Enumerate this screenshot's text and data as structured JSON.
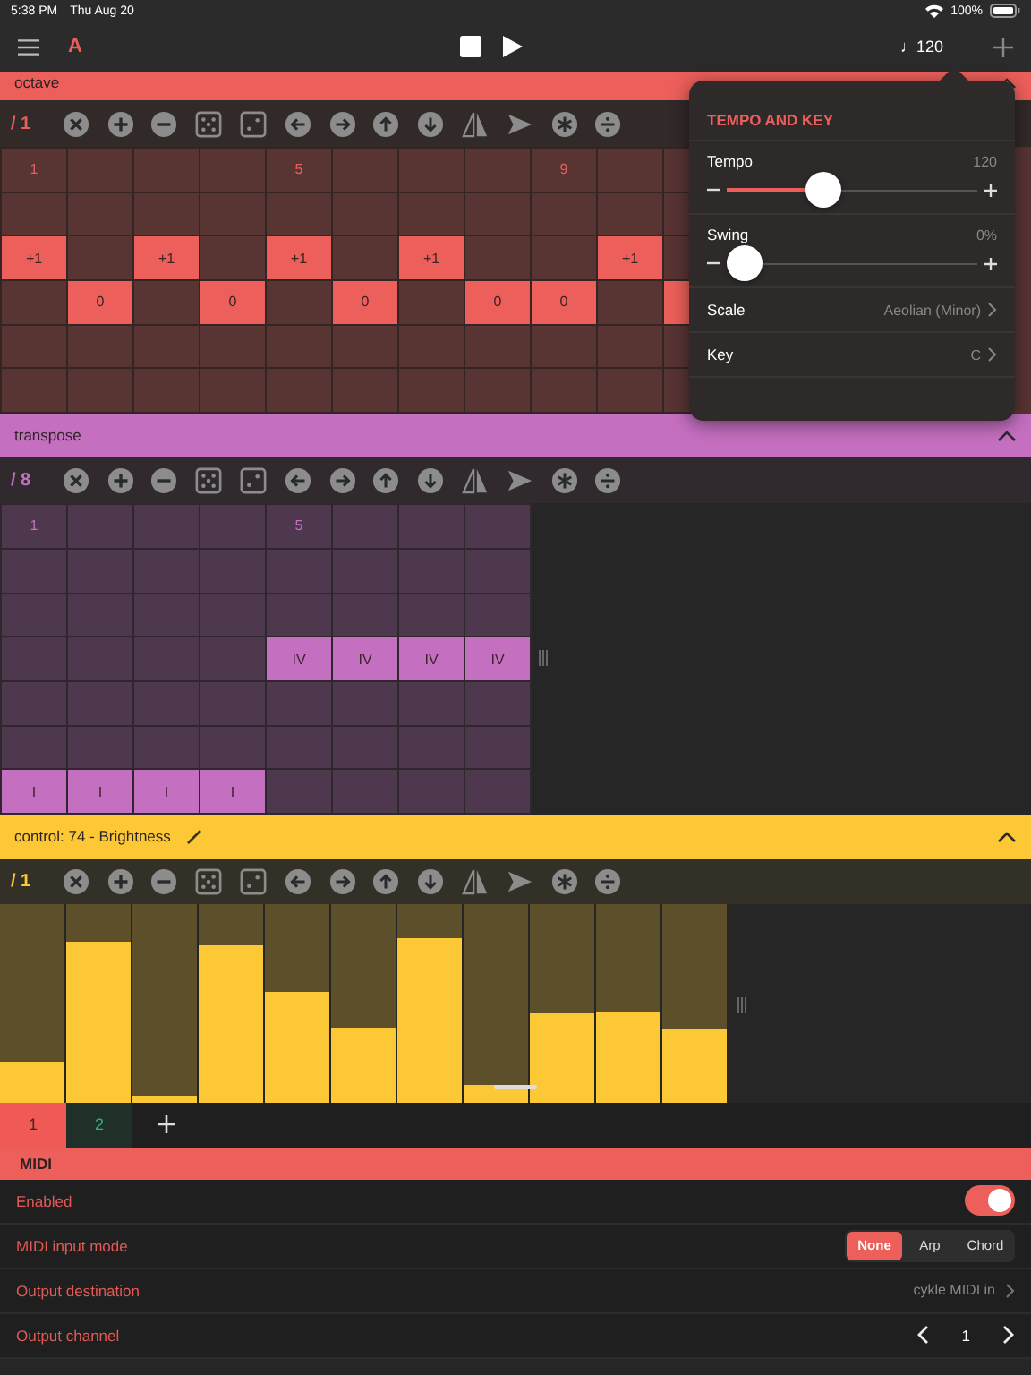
{
  "status_bar": {
    "time": "5:38 PM",
    "date": "Thu Aug 20",
    "battery": "100%"
  },
  "top_bar": {
    "track": "A",
    "tempo": "♩120"
  },
  "lanes": [
    {
      "kind": "grid",
      "title": "octave",
      "color": "#ec5f5a",
      "expanded": true,
      "division": "/ 1",
      "rows": [
        [
          {
            "on": false,
            "text": "1"
          },
          {
            "on": false
          },
          {
            "on": false
          },
          {
            "on": false
          },
          {
            "on": false,
            "text": "5"
          },
          {
            "on": false
          },
          {
            "on": false
          },
          {
            "on": false
          },
          {
            "on": false,
            "text": "9"
          },
          {
            "on": false
          },
          {
            "on": false
          }
        ],
        [
          {
            "on": false
          },
          {
            "on": false
          },
          {
            "on": false
          },
          {
            "on": false
          },
          {
            "on": false
          },
          {
            "on": false
          },
          {
            "on": false
          },
          {
            "on": false
          },
          {
            "on": false
          },
          {
            "on": false
          },
          {
            "on": false
          }
        ],
        [
          {
            "on": true,
            "text": "+1"
          },
          {
            "on": false
          },
          {
            "on": true,
            "text": "+1"
          },
          {
            "on": false
          },
          {
            "on": true,
            "text": "+1"
          },
          {
            "on": false
          },
          {
            "on": true,
            "text": "+1"
          },
          {
            "on": false
          },
          {
            "on": false
          },
          {
            "on": true,
            "text": "+1"
          },
          {
            "on": false
          }
        ],
        [
          {
            "on": false
          },
          {
            "on": true,
            "text": "0"
          },
          {
            "on": false
          },
          {
            "on": true,
            "text": "0"
          },
          {
            "on": false
          },
          {
            "on": true,
            "text": "0"
          },
          {
            "on": false
          },
          {
            "on": true,
            "text": "0"
          },
          {
            "on": true,
            "text": "0"
          },
          {
            "on": false
          },
          {
            "on": true
          }
        ],
        [
          {
            "on": false
          },
          {
            "on": false
          },
          {
            "on": false
          },
          {
            "on": false
          },
          {
            "on": false
          },
          {
            "on": false
          },
          {
            "on": false
          },
          {
            "on": false
          },
          {
            "on": false
          },
          {
            "on": false
          },
          {
            "on": false
          }
        ],
        [
          {
            "on": false
          },
          {
            "on": false
          },
          {
            "on": false
          },
          {
            "on": false
          },
          {
            "on": false
          },
          {
            "on": false
          },
          {
            "on": false
          },
          {
            "on": false
          },
          {
            "on": false
          },
          {
            "on": false
          },
          {
            "on": false
          }
        ]
      ]
    },
    {
      "kind": "grid",
      "title": "transpose",
      "color": "#c56fc0",
      "expanded": true,
      "division": "/ 8",
      "rows": [
        [
          {
            "on": false,
            "text": "1"
          },
          {
            "on": false
          },
          {
            "on": false
          },
          {
            "on": false
          },
          {
            "on": false,
            "text": "5"
          },
          {
            "on": false
          },
          {
            "on": false
          },
          {
            "on": false
          }
        ],
        [
          {
            "on": false
          },
          {
            "on": false
          },
          {
            "on": false
          },
          {
            "on": false
          },
          {
            "on": false
          },
          {
            "on": false
          },
          {
            "on": false
          },
          {
            "on": false
          }
        ],
        [
          {
            "on": false
          },
          {
            "on": false
          },
          {
            "on": false
          },
          {
            "on": false
          },
          {
            "on": false
          },
          {
            "on": false
          },
          {
            "on": false
          },
          {
            "on": false
          }
        ],
        [
          {
            "on": false
          },
          {
            "on": false
          },
          {
            "on": false
          },
          {
            "on": false
          },
          {
            "on": true,
            "text": "IV"
          },
          {
            "on": true,
            "text": "IV"
          },
          {
            "on": true,
            "text": "IV"
          },
          {
            "on": true,
            "text": "IV"
          }
        ],
        [
          {
            "on": false
          },
          {
            "on": false
          },
          {
            "on": false
          },
          {
            "on": false
          },
          {
            "on": false
          },
          {
            "on": false
          },
          {
            "on": false
          },
          {
            "on": false
          }
        ],
        [
          {
            "on": false
          },
          {
            "on": false
          },
          {
            "on": false
          },
          {
            "on": false
          },
          {
            "on": false
          },
          {
            "on": false
          },
          {
            "on": false
          },
          {
            "on": false
          }
        ],
        [
          {
            "on": true,
            "text": "I"
          },
          {
            "on": true,
            "text": "I"
          },
          {
            "on": true,
            "text": "I"
          },
          {
            "on": true,
            "text": "I"
          },
          {
            "on": false
          },
          {
            "on": false
          },
          {
            "on": false
          },
          {
            "on": false
          }
        ]
      ]
    },
    {
      "kind": "bars",
      "title": "control: 74 - Brightness",
      "color": "#fdc835",
      "expanded": true,
      "division": "/ 1",
      "bars": [
        {
          "level": 0.21
        },
        {
          "level": 0.81
        },
        {
          "level": 0.04
        },
        {
          "level": 0.79
        },
        {
          "level": 0.56
        },
        {
          "level": 0.38
        },
        {
          "level": 0.83
        },
        {
          "level": 0.09
        },
        {
          "level": 0.45
        },
        {
          "level": 0.46
        },
        {
          "level": 0.37
        }
      ]
    }
  ],
  "patterns": [
    {
      "label": "1",
      "selected": true,
      "color": "#ef5a55"
    },
    {
      "label": "2",
      "selected": false,
      "color": "#2fb47c"
    }
  ],
  "midi": {
    "title": "MIDI",
    "rows": [
      {
        "kind": "toggle",
        "label": "Enabled",
        "on": true
      },
      {
        "kind": "segmented",
        "label": "MIDI input mode",
        "options": [
          {
            "label": "None",
            "selected": true
          },
          {
            "label": "Arp",
            "selected": false
          },
          {
            "label": "Chord",
            "selected": false
          }
        ]
      },
      {
        "kind": "link",
        "label": "Output destination",
        "value": "cykle MIDI in"
      },
      {
        "kind": "stepper",
        "label": "Output channel",
        "value": "1"
      }
    ]
  },
  "popover": {
    "title": "TEMPO AND KEY",
    "sliders": [
      {
        "label": "Tempo",
        "value": "120",
        "level": 0.37
      },
      {
        "label": "Swing",
        "value": "0%",
        "level": 0
      }
    ],
    "rows": [
      {
        "label": "Scale",
        "value": "Aeolian (Minor)"
      },
      {
        "label": "Key",
        "value": "C"
      }
    ]
  }
}
